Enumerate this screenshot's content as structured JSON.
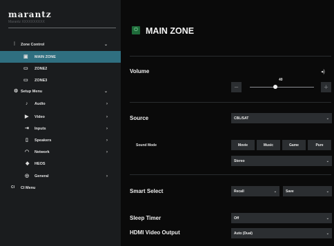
{
  "brand": {
    "name": "marantz",
    "model": "Marantz XXXXXXXXXX"
  },
  "sidebar": {
    "items": [
      {
        "label": "Zone Control",
        "icon": "sliders-icon",
        "glyph": "⫶",
        "chevron": "⌄"
      },
      {
        "label": "MAIN ZONE",
        "icon": "zone-icon",
        "glyph": "▣"
      },
      {
        "label": "ZONE2",
        "icon": "zone-icon",
        "glyph": "▭"
      },
      {
        "label": "ZONE3",
        "icon": "zone-icon",
        "glyph": "▭"
      },
      {
        "label": "Setup Menu",
        "icon": "gear-icon",
        "glyph": "⚙",
        "chevron": "⌄"
      },
      {
        "label": "Audio",
        "icon": "music-note-icon",
        "glyph": "♪",
        "chevron": "›"
      },
      {
        "label": "Video",
        "icon": "video-icon",
        "glyph": "▶",
        "chevron": "›"
      },
      {
        "label": "Inputs",
        "icon": "input-icon",
        "glyph": "⇥",
        "chevron": "›"
      },
      {
        "label": "Speakers",
        "icon": "speaker-icon",
        "glyph": "▯",
        "chevron": "›"
      },
      {
        "label": "Network",
        "icon": "wifi-icon",
        "glyph": "◠",
        "chevron": "›"
      },
      {
        "label": "HEOS",
        "icon": "heos-icon",
        "glyph": "◆"
      },
      {
        "label": "General",
        "icon": "general-icon",
        "glyph": "◎",
        "chevron": "›"
      },
      {
        "label": "CI Menu",
        "icon": "ci-icon",
        "glyph": "CI"
      }
    ]
  },
  "main": {
    "zone_title": "MAIN ZONE",
    "power_glyph": "⏻",
    "volume": {
      "label": "Volume",
      "value": "40",
      "level_fraction": 0.4,
      "minus": "−",
      "plus": "+",
      "speaker_glyph": "◂)"
    },
    "source": {
      "label": "Source",
      "value": "CBL/SAT"
    },
    "sound_mode": {
      "label": "Sound Mode",
      "buttons": [
        "Movie",
        "Music",
        "Game",
        "Pure"
      ],
      "value": "Stereo"
    },
    "smart_select": {
      "label": "Smart Select",
      "recall": "Recall",
      "save": "Save"
    },
    "sleep_timer": {
      "label": "Sleep Timer",
      "value": "Off"
    },
    "hdmi_video_output": {
      "label": "HDMI Video Output",
      "value": "Auto (Dual)"
    },
    "caret": "⌄"
  },
  "colors": {
    "active_item": "#2f6f80",
    "power": "#1e6b3a",
    "field": "#2b2e31"
  }
}
